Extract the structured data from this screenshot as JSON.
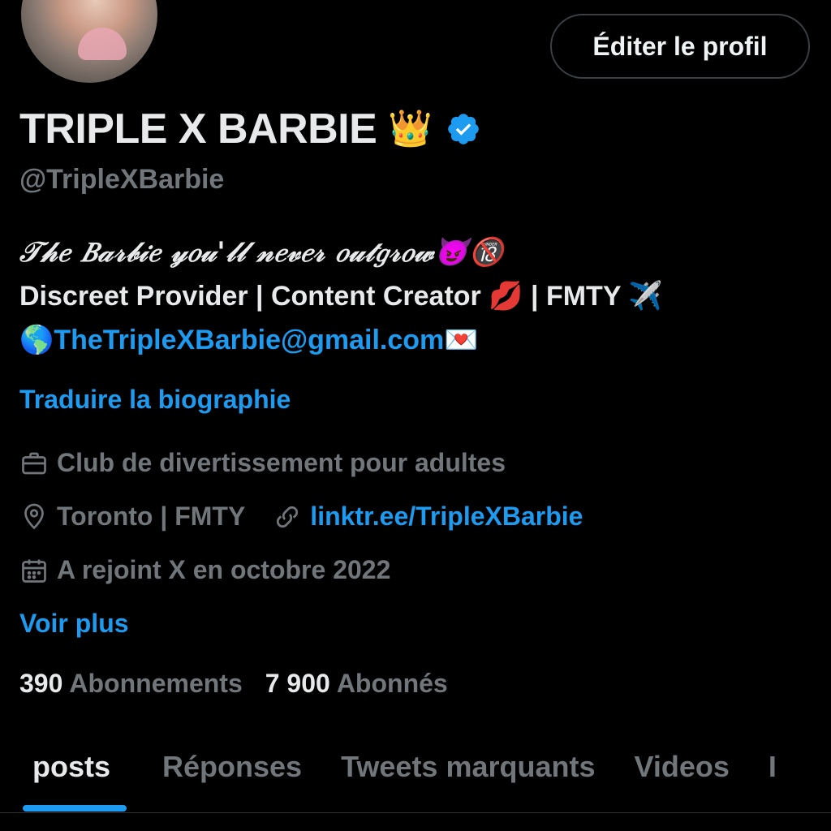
{
  "profile": {
    "edit_button": "Éditer le profil",
    "display_name": "TRIPLE X BARBIE",
    "display_name_emoji": "👑",
    "handle": "@TripleXBarbie"
  },
  "bio": {
    "line1": "𝒯𝒽𝑒 𝐵𝒶𝓇𝒷𝒾𝑒 𝓎𝑜𝓊'𝓁𝓁 𝓃𝑒𝓋𝑒𝓇 𝑜𝓊𝓉𝑔𝓇𝑜𝓌😈🔞",
    "line2": "Discreet Provider | Content Creator 💋 | FMTY ✈️",
    "line3_prefix": "🌎",
    "line3_email": "TheTripleXBarbie@gmail.com",
    "line3_suffix": "💌"
  },
  "translate_link": "Traduire la biographie",
  "meta": {
    "category": "Club de divertissement pour adultes",
    "location": "Toronto | FMTY",
    "website": "linktr.ee/TripleXBarbie",
    "joined": "A rejoint X en octobre 2022"
  },
  "see_more": "Voir plus",
  "stats": {
    "following_count": "390",
    "following_label": "Abonnements",
    "followers_count": "7 900",
    "followers_label": "Abonnés"
  },
  "tabs": [
    "posts",
    "Réponses",
    "Tweets marquants",
    "Videos",
    "I"
  ],
  "colors": {
    "background": "#000000",
    "accent": "#1d9bf0",
    "text_primary": "#e7e9ea",
    "text_secondary": "#71767b"
  },
  "icons": {
    "verified": "verified-badge-icon",
    "category": "briefcase-icon",
    "location": "location-pin-icon",
    "website": "link-icon",
    "joined": "calendar-icon"
  }
}
